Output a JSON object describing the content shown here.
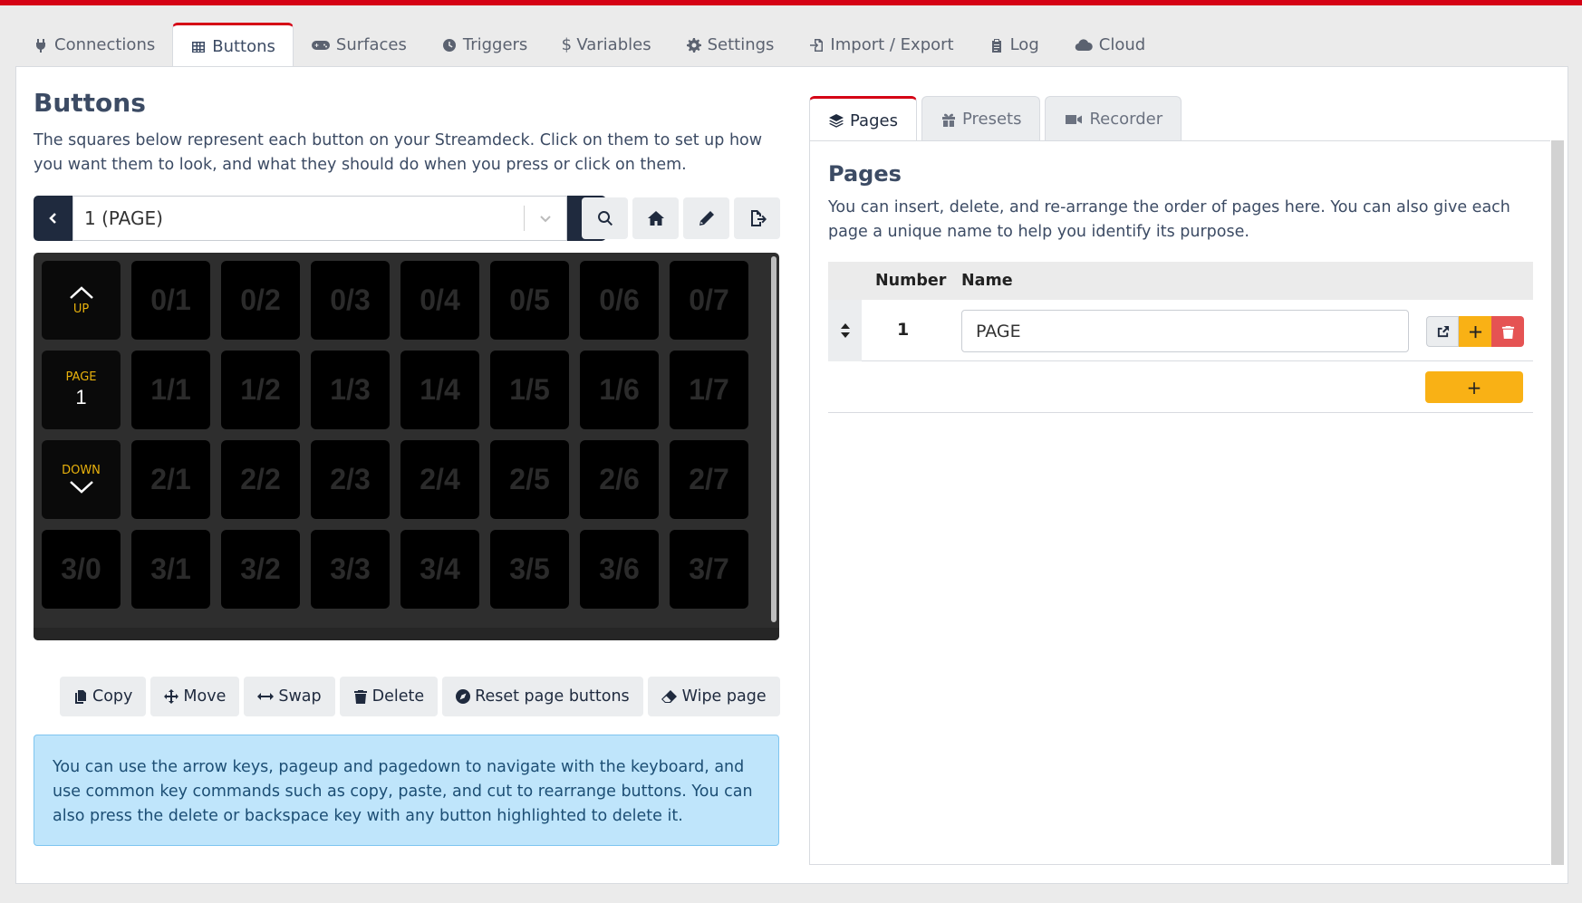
{
  "nav": {
    "tabs": [
      {
        "label": "Connections",
        "icon": "plug-icon"
      },
      {
        "label": "Buttons",
        "icon": "table-icon",
        "active": true
      },
      {
        "label": "Surfaces",
        "icon": "gamepad-icon"
      },
      {
        "label": "Triggers",
        "icon": "clock-icon"
      },
      {
        "label": "Variables",
        "icon": "dollar-icon"
      },
      {
        "label": "Settings",
        "icon": "gear-icon"
      },
      {
        "label": "Import / Export",
        "icon": "file-import-icon"
      },
      {
        "label": "Log",
        "icon": "clipboard-icon"
      },
      {
        "label": "Cloud",
        "icon": "cloud-icon"
      }
    ]
  },
  "buttons": {
    "title": "Buttons",
    "description": "The squares below represent each button on your Streamdeck. Click on them to set up how you want them to look, and what they should do when you press or click on them.",
    "page_select": "1 (PAGE)",
    "grid": {
      "up_label": "UP",
      "page_label": "PAGE",
      "page_number": "1",
      "down_label": "DOWN",
      "rows": [
        [
          "",
          "0/1",
          "0/2",
          "0/3",
          "0/4",
          "0/5",
          "0/6",
          "0/7"
        ],
        [
          "",
          "1/1",
          "1/2",
          "1/3",
          "1/4",
          "1/5",
          "1/6",
          "1/7"
        ],
        [
          "",
          "2/1",
          "2/2",
          "2/3",
          "2/4",
          "2/5",
          "2/6",
          "2/7"
        ],
        [
          "3/0",
          "3/1",
          "3/2",
          "3/3",
          "3/4",
          "3/5",
          "3/6",
          "3/7"
        ]
      ]
    },
    "actions": {
      "copy": "Copy",
      "move": "Move",
      "swap": "Swap",
      "delete": "Delete",
      "reset": "Reset page buttons",
      "wipe": "Wipe page"
    },
    "info": "You can use the arrow keys, pageup and pagedown to navigate with the keyboard, and use common key commands such as copy, paste, and cut to rearrange buttons. You can also press the delete or backspace key with any button highlighted to delete it."
  },
  "right": {
    "tabs": [
      {
        "label": "Pages",
        "icon": "layers-icon",
        "active": true
      },
      {
        "label": "Presets",
        "icon": "gift-icon"
      },
      {
        "label": "Recorder",
        "icon": "video-icon"
      }
    ],
    "title": "Pages",
    "description": "You can insert, delete, and re-arrange the order of pages here. You can also give each page a unique name to help you identify its purpose.",
    "table": {
      "col_number": "Number",
      "col_name": "Name",
      "rows": [
        {
          "number": "1",
          "name": "PAGE"
        }
      ]
    },
    "add_label": "+"
  },
  "colors": {
    "accent": "#d50215",
    "dark": "#1f2a3e",
    "warning": "#f9b115",
    "danger": "#e55353",
    "info_bg": "#bfe5fb"
  }
}
